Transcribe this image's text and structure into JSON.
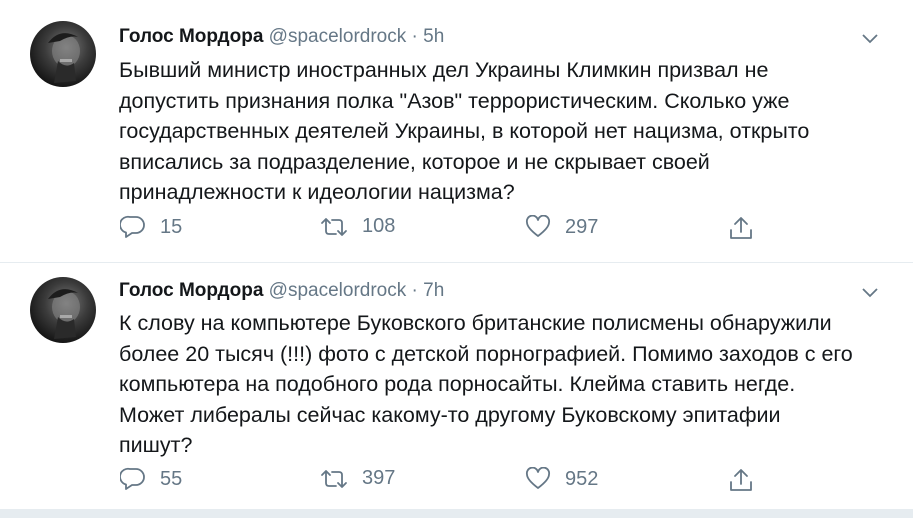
{
  "tweets": [
    {
      "name": "Голос Мордора",
      "handle": "@spacelordrock",
      "separator": "·",
      "time": "5h",
      "text": "Бывший министр иностранных дел Украины Климкин призвал не\nдопустить признания полка \"Азов\" террористическим. Сколько уже\nгосударственных деятелей Украины, в которой нет нацизма, открыто\nвписались за подразделение, которое и не скрывает своей\nпринадлежности к идеологии нацизма?",
      "replies": "15",
      "retweets": "108",
      "likes": "297"
    },
    {
      "name": "Голос Мордора",
      "handle": "@spacelordrock",
      "separator": "·",
      "time": "7h",
      "text": "К слову на компьютере Буковского британские полисмены обнаружили\nболее 20 тысяч (!!!) фото с детской порнографией. Помимо заходов с его\nкомпьютера на подобного рода порносайты. Клейма ставить негде.\nМожет либералы сейчас какому-то другому Буковскому эпитафии\nпишут?",
      "replies": "55",
      "retweets": "397",
      "likes": "952"
    }
  ],
  "icons": {
    "reply": "reply-icon",
    "retweet": "retweet-icon",
    "like": "heart-icon",
    "share": "share-icon",
    "caret": "chevron-down-icon"
  },
  "colors": {
    "text": "#14171a",
    "secondary": "#657786",
    "divider": "#e6ecf0"
  }
}
